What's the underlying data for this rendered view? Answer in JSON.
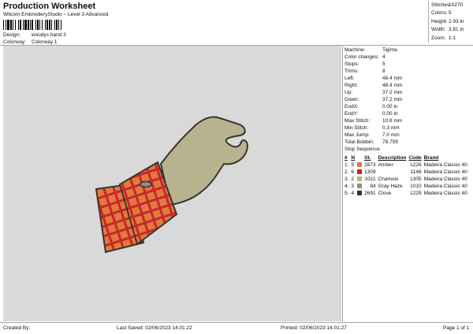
{
  "header": {
    "title": "Production Worksheet",
    "subtitle": "Wilcom EmbroideryStudio – Level 3 Advanced",
    "design_label": "Design:",
    "design_value": "woodys hand 3",
    "colorway_label": "Colorway:",
    "colorway_value": "Colorway 1"
  },
  "stats": [
    {
      "label": "Stitches:",
      "value": "10270"
    },
    {
      "label": "Colors:",
      "value": "5"
    },
    {
      "label": "Height:",
      "value": "2.93 in"
    },
    {
      "label": "Width:",
      "value": "3.81 in"
    },
    {
      "label": "Zoom:",
      "value": "1:1"
    }
  ],
  "info": [
    {
      "label": "Machine:",
      "value": "Tajima"
    },
    {
      "label": "Color changes:",
      "value": "4"
    },
    {
      "label": "Stops:",
      "value": "5"
    },
    {
      "label": "Trims:",
      "value": "8"
    },
    {
      "label": "Left:",
      "value": "48.4 mm"
    },
    {
      "label": "Right:",
      "value": "48.4 mm"
    },
    {
      "label": "Up:",
      "value": "37.2 mm"
    },
    {
      "label": "Down:",
      "value": "37.2 mm"
    },
    {
      "label": "EndX:",
      "value": "0.00 in"
    },
    {
      "label": "EndY:",
      "value": "0.00 in"
    },
    {
      "label": "Max Stitch:",
      "value": "10.8 mm"
    },
    {
      "label": "Min Stitch:",
      "value": "0.3 mm"
    },
    {
      "label": "Max Jump:",
      "value": "7.0 mm"
    },
    {
      "label": "Total Bobbin:",
      "value": "78.75ft"
    }
  ],
  "stop_sequence": {
    "title": "Stop Sequence:",
    "headers": [
      "#",
      "N",
      "St.",
      "Description",
      "Code",
      "Brand"
    ],
    "rows": [
      {
        "num": "1.",
        "n": "5",
        "color": "#e07b3c",
        "st": "2873",
        "desc": "Amber",
        "code": "1226",
        "brand": "Madeira Classic 40"
      },
      {
        "num": "2.",
        "n": "6",
        "color": "#d21f2a",
        "st": "1309",
        "desc": "",
        "code": "1146",
        "brand": "Madeira Classic 40"
      },
      {
        "num": "3.",
        "n": "2",
        "color": "#b7b38e",
        "st": "3311",
        "desc": "Chamois",
        "code": "1305",
        "brand": "Madeira Classic 40"
      },
      {
        "num": "4.",
        "n": "3",
        "color": "#8f8f8f",
        "st": "84",
        "desc": "Gray Haze",
        "code": "1010",
        "brand": "Madeira Classic 40"
      },
      {
        "num": "5.",
        "n": "4",
        "color": "#3a352c",
        "st": "2691",
        "desc": "Clove",
        "code": "1229",
        "brand": "Madeira Classic 40"
      }
    ]
  },
  "footer": {
    "created_by": "Created By:",
    "last_saved": "Last Saved: 02/06/2023 14.01.22",
    "printed": "Printed: 02/06/2023 14.01.27",
    "page": "Page 1 of 1"
  }
}
